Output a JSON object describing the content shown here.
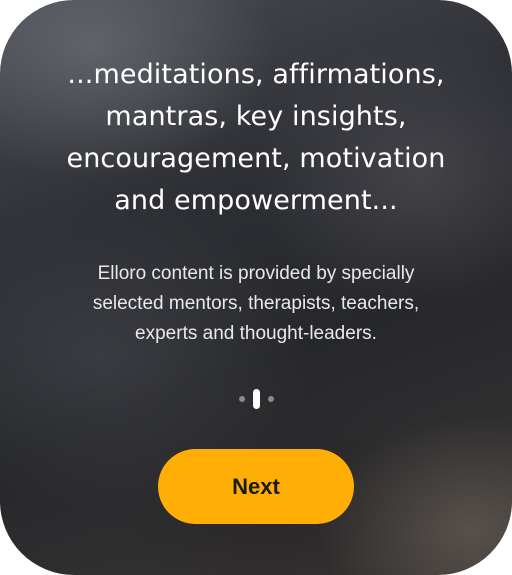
{
  "onboarding": {
    "headline_lines": [
      "...meditations, affirmations,",
      "mantras, key insights,",
      "encouragement, motivation",
      "and empowerment..."
    ],
    "body_lines": [
      "Elloro content is provided by specially",
      "selected mentors, therapists, teachers,",
      "experts and thought-leaders."
    ],
    "page_indicator": {
      "total_pages": 3,
      "current_page": 2
    },
    "next_label": "Next"
  },
  "colors": {
    "accent": "#ffae05",
    "text_primary": "#ffffff",
    "text_secondary": "#e9e9ec",
    "background_dark": "#2d2f34"
  }
}
